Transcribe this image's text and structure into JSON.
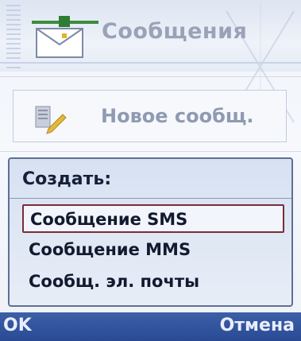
{
  "app": {
    "title": "Сообщения"
  },
  "list": {
    "new_message_label": "Новое сообщ."
  },
  "popup": {
    "header": "Создать:",
    "items": [
      {
        "label": "Сообщение SMS",
        "selected": true
      },
      {
        "label": "Сообщение MMS",
        "selected": false
      },
      {
        "label": "Сообщ. эл. почты",
        "selected": false
      }
    ]
  },
  "softkeys": {
    "left": "OK",
    "right": "Отмена"
  },
  "colors": {
    "softbar": "#2f509c",
    "selection_border": "#7c2c3a",
    "popup_border": "#5f6f95",
    "title_text": "#9aa2b8"
  },
  "icons": {
    "app": "messages-envelope-icon",
    "new_message": "new-message-icon"
  }
}
